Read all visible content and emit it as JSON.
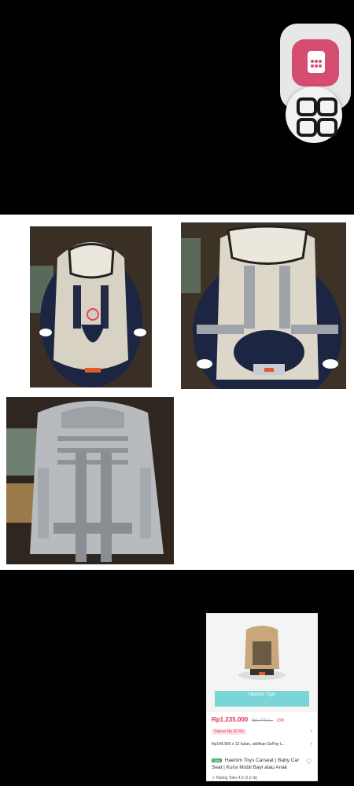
{
  "product_card": {
    "banner_text": "Haenim Toys",
    "price": "Rp1.235.000",
    "original_price": "Rp1.470.0...",
    "discount": "33%",
    "promo_label": "Diskon Rp.50 Rb",
    "installment": "Rp149.955 x 12 bulan, aktifkan GoPay L...",
    "title_tag": "Sale",
    "title": "Haenim Toys Carseat | Baby Car Seat | Kursi Mobil Bayi atau Anak",
    "rating": "Rating Toko 4.9",
    "rating_extra": "(2.0 rb)"
  },
  "colors": {
    "accent_pink": "#d54d71",
    "price_red": "#e0324d",
    "banner_teal": "#7ad6d6"
  },
  "icons": {
    "floating_app": "app-shortcut-icon",
    "menu": "grid-menu-icon",
    "wishlist": "heart-icon",
    "chevron": "chevron-right-icon",
    "star": "star-icon"
  }
}
